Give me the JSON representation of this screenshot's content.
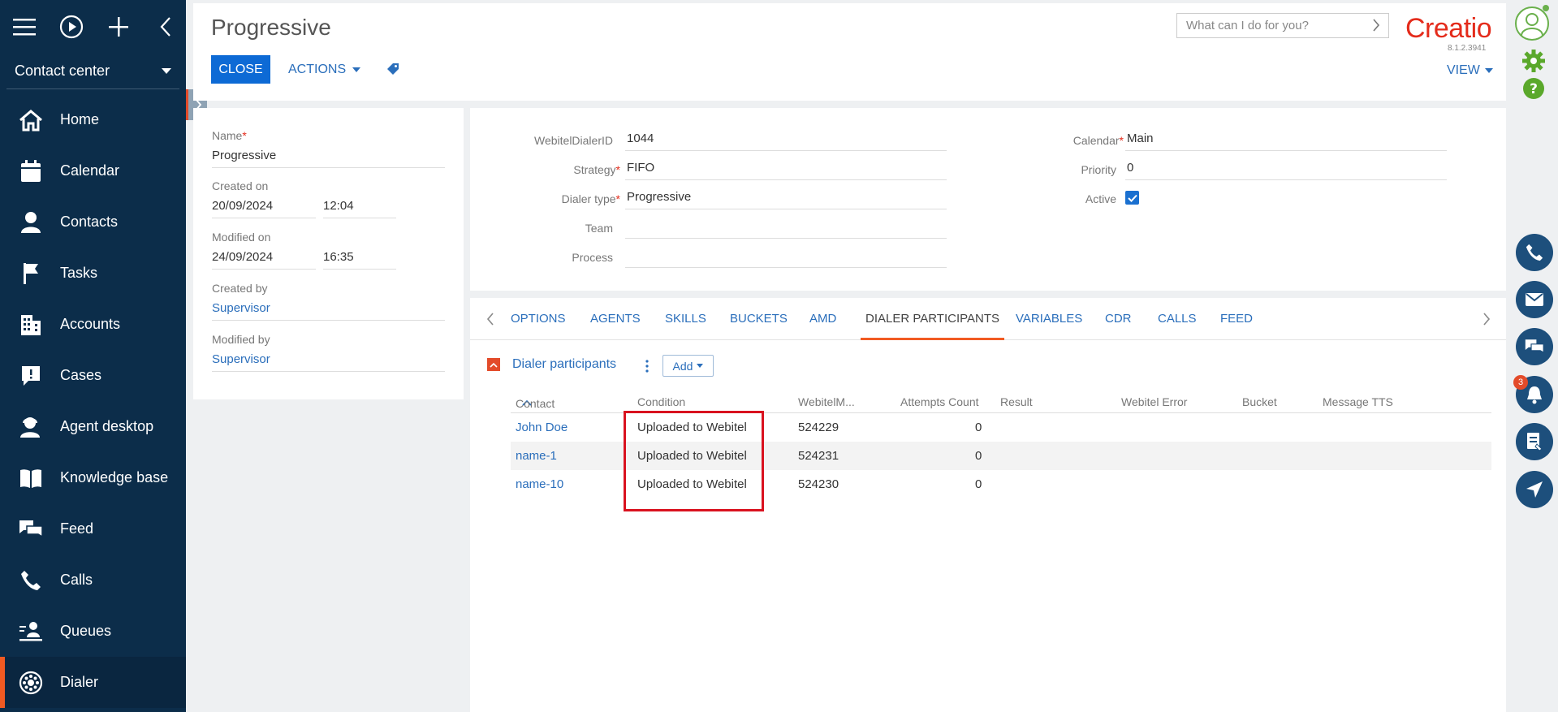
{
  "sidebar": {
    "workplace": "Contact center",
    "items": [
      {
        "label": "Home",
        "icon": "home-icon"
      },
      {
        "label": "Calendar",
        "icon": "calendar-icon"
      },
      {
        "label": "Contacts",
        "icon": "contacts-icon"
      },
      {
        "label": "Tasks",
        "icon": "tasks-icon"
      },
      {
        "label": "Accounts",
        "icon": "accounts-icon"
      },
      {
        "label": "Cases",
        "icon": "cases-icon"
      },
      {
        "label": "Agent desktop",
        "icon": "agent-desktop-icon"
      },
      {
        "label": "Knowledge base",
        "icon": "knowledge-base-icon"
      },
      {
        "label": "Feed",
        "icon": "feed-icon"
      },
      {
        "label": "Calls",
        "icon": "calls-icon"
      },
      {
        "label": "Queues",
        "icon": "queues-icon"
      },
      {
        "label": "Dialer",
        "icon": "dialer-icon"
      }
    ],
    "active_item": "Dialer"
  },
  "header": {
    "title": "Progressive",
    "close_label": "CLOSE",
    "actions_label": "ACTIONS",
    "search_placeholder": "What can I do for you?",
    "logo": "Creatio",
    "version": "8.1.2.3941",
    "view_label": "VIEW"
  },
  "left_card": {
    "name_label": "Name",
    "name_value": "Progressive",
    "created_on_label": "Created on",
    "created_date": "20/09/2024",
    "created_time": "12:04",
    "modified_on_label": "Modified on",
    "modified_date": "24/09/2024",
    "modified_time": "16:35",
    "created_by_label": "Created by",
    "created_by": "Supervisor",
    "modified_by_label": "Modified by",
    "modified_by": "Supervisor"
  },
  "main_fields": {
    "dialer_id_label": "WebitelDialerID",
    "dialer_id": "1044",
    "strategy_label": "Strategy",
    "strategy": "FIFO",
    "dialer_type_label": "Dialer type",
    "dialer_type": "Progressive",
    "team_label": "Team",
    "team": "",
    "process_label": "Process",
    "process": "",
    "calendar_label": "Calendar",
    "calendar": "Main",
    "priority_label": "Priority",
    "priority": "0",
    "active_label": "Active",
    "active": true
  },
  "tabs": [
    "OPTIONS",
    "AGENTS",
    "SKILLS",
    "BUCKETS",
    "AMD",
    "DIALER PARTICIPANTS",
    "VARIABLES",
    "CDR",
    "CALLS",
    "FEED"
  ],
  "active_tab": "DIALER PARTICIPANTS",
  "detail": {
    "title": "Dialer participants",
    "add_label": "Add",
    "columns": [
      "Contact",
      "Condition",
      "WebitelM...",
      "Attempts Count",
      "Result",
      "Webitel Error",
      "Bucket",
      "Message TTS"
    ],
    "rows": [
      {
        "contact": "John Doe",
        "condition": "Uploaded to Webitel",
        "webitel_m": "524229",
        "attempts": "0"
      },
      {
        "contact": "name-1",
        "condition": "Uploaded to Webitel",
        "webitel_m": "524231",
        "attempts": "0"
      },
      {
        "contact": "name-10",
        "condition": "Uploaded to Webitel",
        "webitel_m": "524230",
        "attempts": "0"
      }
    ]
  },
  "rail": {
    "notification_count": "3"
  },
  "colors": {
    "sidebar_bg": "#0c2d4a",
    "accent": "#f15a22",
    "primary_button": "#0d6ad5",
    "link": "#2a6ebb",
    "highlight_box": "#d9121f"
  }
}
